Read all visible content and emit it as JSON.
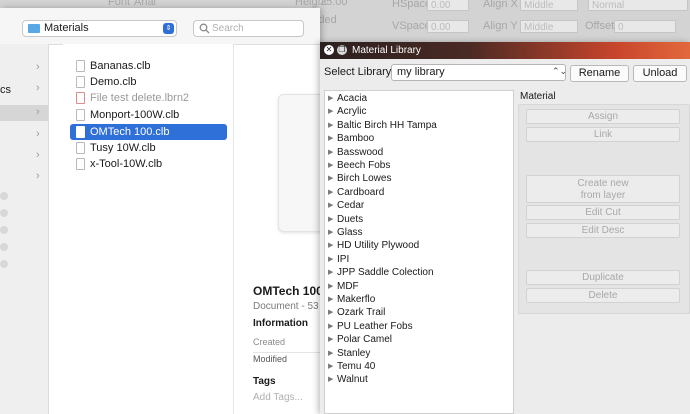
{
  "background_toolbar": {
    "font_label": "Font",
    "font_value": "Arial",
    "height_label": "Height",
    "height_value": "25.00",
    "hspace_label": "HSpace",
    "hspace_value": "0.00",
    "vspace_label": "VSpace",
    "vspace_value": "0.00",
    "alignx_label": "Align X",
    "alignx_value": "Middle",
    "aligny_label": "Align Y",
    "aligny_value": "Middle",
    "style_value": "Normal",
    "offset_label": "Offset",
    "offset_value": "0",
    "welded_label": "lded"
  },
  "finder": {
    "path_label": "Materials",
    "search_placeholder": "Search",
    "sidebar_fragment": "cs",
    "files": [
      {
        "name": "Bananas.clb",
        "selected": false,
        "dim": false
      },
      {
        "name": "Demo.clb",
        "selected": false,
        "dim": false
      },
      {
        "name": "File test delete.lbrn2",
        "selected": false,
        "dim": true
      },
      {
        "name": "Monport-100W.clb",
        "selected": false,
        "dim": false
      },
      {
        "name": "OMTech 100.clb",
        "selected": true,
        "dim": false
      },
      {
        "name": "Tusy 10W.clb",
        "selected": false,
        "dim": false
      },
      {
        "name": "x-Tool-10W.clb",
        "selected": false,
        "dim": false
      }
    ],
    "preview": {
      "title": "OMTech 100",
      "subtitle": "Document - 53",
      "info_heading": "Information",
      "created_label": "Created",
      "modified_label": "Modified",
      "tags_heading": "Tags",
      "tags_placeholder": "Add Tags..."
    }
  },
  "material_library": {
    "title": "Material Library",
    "select_label": "Select Library",
    "library_value": "my library",
    "rename_label": "Rename",
    "unload_label": "Unload",
    "material_heading": "Material",
    "materials": [
      "Acacia",
      "Acrylic",
      "Baltic Birch HH Tampa",
      "Bamboo",
      "Basswood",
      "Beech Fobs",
      "Birch Lowes",
      "Cardboard",
      "Cedar",
      "Duets",
      "Glass",
      "HD Utility Plywood",
      "IPI",
      "JPP Saddle Colection",
      "MDF",
      "Makerflo",
      "Ozark Trail",
      "PU Leather Fobs",
      "Polar Camel",
      "Stanley",
      "Temu 40",
      "Walnut"
    ],
    "buttons": {
      "assign": "Assign",
      "link": "Link",
      "create_line1": "Create new",
      "create_line2": "from layer",
      "edit_cut": "Edit Cut",
      "edit_desc": "Edit Desc",
      "duplicate": "Duplicate",
      "delete": "Delete"
    }
  },
  "colors": {
    "selection": "#2f6fd8",
    "titlebar_accent": "#e2683c"
  }
}
